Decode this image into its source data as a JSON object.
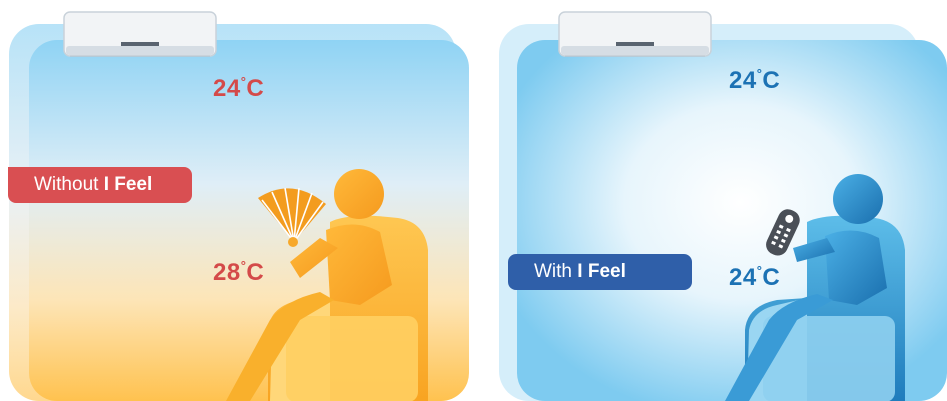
{
  "left_panel": {
    "top_temp": {
      "value": "24",
      "unit": "°C"
    },
    "bottom_temp": {
      "value": "28",
      "unit": "°C"
    },
    "label": {
      "prefix": "Without ",
      "emphasis": "I Feel"
    }
  },
  "right_panel": {
    "top_temp": {
      "value": "24",
      "unit": "°C"
    },
    "bottom_temp": {
      "value": "24",
      "unit": "°C"
    },
    "label": {
      "prefix": "With ",
      "emphasis": "I Feel"
    }
  },
  "colors": {
    "warm_text": "#d44a49",
    "cool_text": "#1c72b4",
    "warm_label": "#d94f52",
    "cool_label": "#2f5fa9",
    "warm_figure": "#f5a623",
    "cool_figure": "#2a86c8",
    "sky_blue": "#86cdf0"
  },
  "icons": [
    "air-conditioner-icon",
    "hand-fan-icon",
    "remote-control-icon",
    "person-figure-icon",
    "armchair-icon"
  ]
}
